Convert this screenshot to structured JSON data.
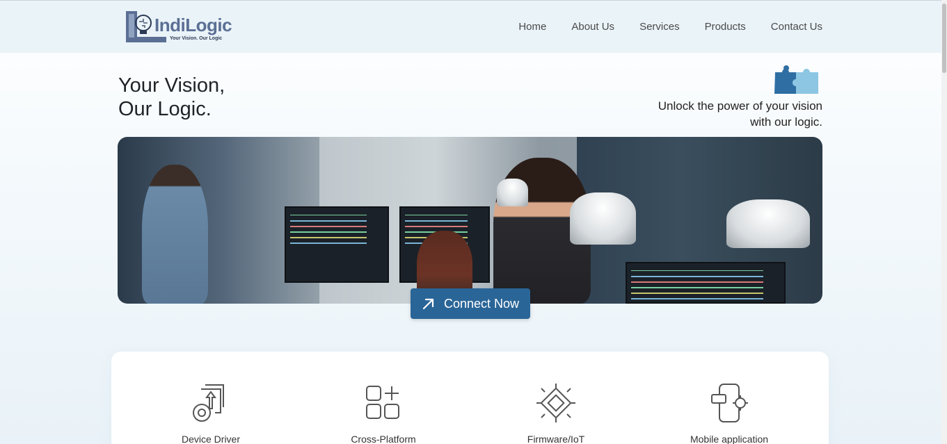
{
  "brand": {
    "name": "IndiLogic",
    "tagline": "Your Vision. Our Logic",
    "colors": {
      "primary": "#2a6597",
      "logo": "#5b6f95",
      "header_bg": "#eaf3f8"
    }
  },
  "nav": {
    "items": [
      {
        "label": "Home"
      },
      {
        "label": "About Us"
      },
      {
        "label": "Services"
      },
      {
        "label": "Products"
      },
      {
        "label": "Contact Us"
      }
    ]
  },
  "hero": {
    "title_line1": "Your Vision,",
    "title_line2": "Our Logic.",
    "subtitle_line1": "Unlock the power of your vision",
    "subtitle_line2": "with our logic.",
    "icon": "puzzle-icon",
    "image": "office-team-photo"
  },
  "cta": {
    "label": "Connect Now",
    "icon": "arrow-up-right-icon"
  },
  "services": {
    "items": [
      {
        "label": "Device Driver",
        "icon": "device-driver-icon"
      },
      {
        "label": "Cross-Platform",
        "icon": "cross-platform-icon"
      },
      {
        "label": "Firmware/IoT",
        "icon": "chip-icon"
      },
      {
        "label": "Mobile application",
        "icon": "mobile-app-icon"
      }
    ]
  }
}
